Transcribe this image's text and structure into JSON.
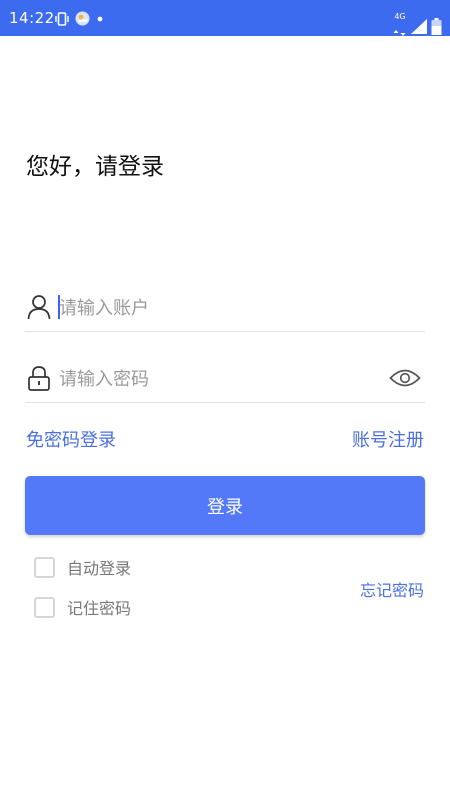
{
  "status_bar": {
    "time": "14:22",
    "network": "4G",
    "icons": [
      "vibrate-icon",
      "weather-icon",
      "dot-icon",
      "signal-icon",
      "battery-icon"
    ]
  },
  "greeting": "您好，请登录",
  "account": {
    "placeholder": "请输入账户",
    "value": ""
  },
  "password": {
    "placeholder": "请输入密码",
    "value": ""
  },
  "links": {
    "no_password_login": "免密码登录",
    "register": "账号注册"
  },
  "login_button": "登录",
  "options": {
    "auto_login": "自动登录",
    "remember_password": "记住密码"
  },
  "forgot_password": "忘记密码",
  "colors": {
    "status_bar": "#3d6bf0",
    "accent": "#4a6fe3",
    "button": "#5379f8"
  }
}
